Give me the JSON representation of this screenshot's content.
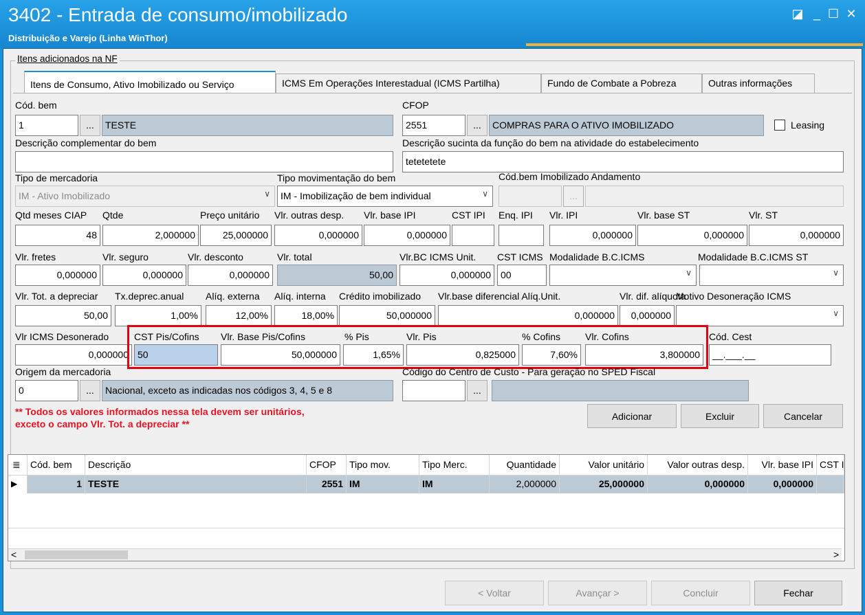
{
  "window": {
    "title": "3402 - Entrada de consumo/imobilizado",
    "subtitle": "Distribuição e Varejo (Linha WinThor)",
    "restore_glyph": "◪",
    "minimize_glyph": "_",
    "maximize_glyph": "☐",
    "close_glyph": "✕"
  },
  "group_label": "Itens adicionados na NF",
  "tabs": [
    {
      "label": "Itens de Consumo,  Ativo Imobilizado ou Serviço",
      "active": true
    },
    {
      "label": "ICMS Em Operações Interestadual (ICMS Partilha)",
      "active": false
    },
    {
      "label": "Fundo de Combate a Pobreza",
      "active": false
    },
    {
      "label": "Outras informações",
      "active": false
    }
  ],
  "form": {
    "cod_bem": {
      "label": "Cód. bem",
      "value": "1",
      "desc": "TESTE"
    },
    "cfop": {
      "label": "CFOP",
      "value": "2551",
      "desc": "COMPRAS PARA O ATIVO IMOBILIZADO"
    },
    "leasing": {
      "label": "Leasing",
      "checked": false
    },
    "descricao_complementar": {
      "label": "Descrição complementar do bem",
      "value": ""
    },
    "descricao_sucinta": {
      "label": "Descrição sucinta da função do bem na atividade do estabelecimento",
      "value": "tetetetete"
    },
    "tipo_mercadoria": {
      "label": "Tipo de mercadoria",
      "value": "IM - Ativo Imobilizado"
    },
    "tipo_movimentacao": {
      "label": "Tipo movimentação do bem",
      "value": "IM - Imobilização de bem individual"
    },
    "cod_bem_andamento": {
      "label": "Cód.bem Imobilizado Andamento",
      "value": "",
      "desc": ""
    },
    "qtd_meses_ciap": {
      "label": "Qtd meses CIAP",
      "value": "48"
    },
    "qtde": {
      "label": "Qtde",
      "value": "2,000000"
    },
    "preco_unitario": {
      "label": "Preço unitário",
      "value": "25,000000"
    },
    "vlr_outras_desp": {
      "label": "Vlr. outras desp.",
      "value": "0,000000"
    },
    "vlr_base_ipi": {
      "label": "Vlr. base IPI",
      "value": "0,000000"
    },
    "cst_ipi": {
      "label": "CST IPI",
      "value": ""
    },
    "enq_ipi": {
      "label": "Enq. IPI",
      "value": ""
    },
    "vlr_ipi": {
      "label": "Vlr. IPI",
      "value": "0,000000"
    },
    "vlr_base_st": {
      "label": "Vlr. base ST",
      "value": "0,000000"
    },
    "vlr_st": {
      "label": "Vlr. ST",
      "value": "0,000000"
    },
    "vlr_fretes": {
      "label": "Vlr. fretes",
      "value": "0,000000"
    },
    "vlr_seguro": {
      "label": "Vlr. seguro",
      "value": "0,000000"
    },
    "vlr_desconto": {
      "label": "Vlr. desconto",
      "value": "0,000000"
    },
    "vlr_total": {
      "label": "Vlr. total",
      "value": "50,00"
    },
    "vlr_bc_icms_unit": {
      "label": "Vlr.BC ICMS Unit.",
      "value": "0,000000"
    },
    "cst_icms": {
      "label": "CST ICMS",
      "value": "00"
    },
    "modalidade_bc_icms": {
      "label": "Modalidade B.C.ICMS",
      "value": ""
    },
    "modalidade_bc_icms_st": {
      "label": "Modalidade B.C.ICMS ST",
      "value": ""
    },
    "vlr_tot_depreciar": {
      "label": "Vlr. Tot. a depreciar",
      "value": "50,00"
    },
    "tx_deprec_anual": {
      "label": "Tx.deprec.anual",
      "value": "1,00%"
    },
    "aliq_externa": {
      "label": "Alíq. externa",
      "value": "12,00%"
    },
    "aliq_interna": {
      "label": "Alíq. interna",
      "value": "18,00%"
    },
    "credito_imobilizado": {
      "label": "Crédito imobilizado",
      "value": "50,000000"
    },
    "vlr_base_diferencial": {
      "label": "Vlr.base diferencial Alíq.Unit.",
      "value": "0,000000"
    },
    "vlr_dif_aliquota": {
      "label": "Vlr. dif. alíquota",
      "value": "0,000000"
    },
    "motivo_desoneracao": {
      "label": "Motivo Desoneração ICMS",
      "value": ""
    },
    "vlr_icms_desonerado": {
      "label": "Vlr ICMS Desonerado",
      "value": "0,000000"
    },
    "cst_pis_cofins": {
      "label": "CST Pis/Cofins",
      "value": "50"
    },
    "vlr_base_pis_cofins": {
      "label": "Vlr. Base Pis/Cofins",
      "value": "50,000000"
    },
    "pct_pis": {
      "label": "% Pis",
      "value": "1,65%"
    },
    "vlr_pis": {
      "label": "Vlr. Pis",
      "value": "0,825000"
    },
    "pct_cofins": {
      "label": "% Cofins",
      "value": "7,60%"
    },
    "vlr_cofins": {
      "label": "Vlr. Cofins",
      "value": "3,800000"
    },
    "cod_cest": {
      "label": "Cód. Cest",
      "value": "__.___.__"
    },
    "origem": {
      "label": "Origem da mercadoria",
      "value": "0",
      "desc": "Nacional, exceto as indicadas nos códigos 3, 4, 5 e 8"
    },
    "centro_custo": {
      "label": "Código do Centro de Custo - Para geração no SPED Fiscal",
      "value": "",
      "desc": ""
    },
    "dots": "..."
  },
  "warning": {
    "line1": "** Todos os valores informados nessa tela devem ser unitários,",
    "line2": "exceto o campo Vlr. Tot. a depreciar **"
  },
  "actions": {
    "adicionar": "Adicionar",
    "excluir": "Excluir",
    "cancelar": "Cancelar"
  },
  "grid": {
    "corner_glyph": "≣",
    "row_pointer": "▶",
    "headers": [
      "Cód. bem",
      "Descrição",
      "CFOP",
      "Tipo mov.",
      "Tipo Merc.",
      "Quantidade",
      "Valor unitário",
      "Valor outras desp.",
      "Vlr. base IPI",
      "CST I"
    ],
    "rows": [
      [
        "1",
        "TESTE",
        "2551",
        "IM",
        "IM",
        "2,000000",
        "25,000000",
        "0,000000",
        "0,000000",
        ""
      ]
    ],
    "scroll_left": "<",
    "scroll_right": ">"
  },
  "footer": {
    "voltar": "< Voltar",
    "avancar": "Avançar >",
    "concluir": "Concluir",
    "fechar": "Fechar"
  },
  "colors": {
    "titlebar": "#1e8fd6",
    "accent": "#f2b233",
    "highlight_box": "#e3000f",
    "warning_text": "#e81123",
    "readonly_field": "#bccad5"
  }
}
